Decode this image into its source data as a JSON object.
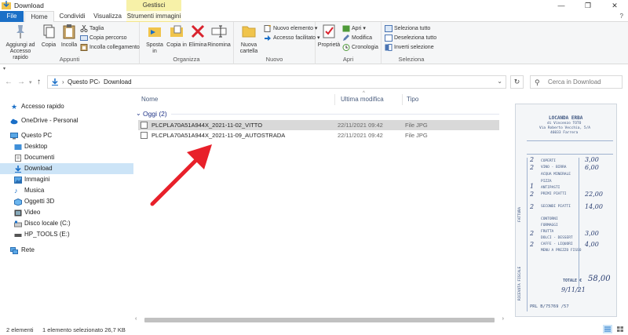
{
  "window": {
    "title": "Download",
    "controls": [
      "—",
      "❐",
      "✕"
    ]
  },
  "ribbon_tabs": {
    "file": "File",
    "home": "Home",
    "condividi": "Condividi",
    "visualizza": "Visualizza",
    "gestisci": "Gestisci",
    "strumenti": "Strumenti immagini",
    "help": "?"
  },
  "ribbon": {
    "appunti": {
      "label": "Appunti",
      "aggiungi": "Aggiungi ad Accesso rapido",
      "copia": "Copia",
      "incolla": "Incolla",
      "taglia": "Taglia",
      "copia_percorso": "Copia percorso",
      "incolla_collegamento": "Incolla collegamento"
    },
    "organizza": {
      "label": "Organizza",
      "sposta": "Sposta in",
      "copia_in": "Copia in",
      "elimina": "Elimina",
      "rinomina": "Rinomina"
    },
    "nuovo": {
      "label": "Nuovo",
      "nuova_cartella": "Nuova cartella",
      "nuovo_elemento": "Nuovo elemento",
      "accesso_facilitato": "Accesso facilitato"
    },
    "apri": {
      "label": "Apri",
      "proprieta": "Proprietà",
      "apri": "Apri",
      "modifica": "Modifica",
      "cronologia": "Cronologia"
    },
    "seleziona": {
      "label": "Seleziona",
      "seleziona_tutto": "Seleziona tutto",
      "deseleziona_tutto": "Deseleziona tutto",
      "inverti": "Inverti selezione"
    }
  },
  "address": {
    "crumbs": [
      "Questo PC",
      "Download"
    ],
    "search_placeholder": "Cerca in Download"
  },
  "nav": {
    "items": [
      {
        "label": "Accesso rapido",
        "icon": "star-icon"
      },
      {
        "label": "OneDrive - Personal",
        "icon": "cloud-icon"
      },
      {
        "label": "Questo PC",
        "icon": "computer-icon"
      },
      {
        "label": "Desktop",
        "icon": "folder-icon"
      },
      {
        "label": "Documenti",
        "icon": "documents-icon"
      },
      {
        "label": "Download",
        "icon": "download-icon"
      },
      {
        "label": "Immagini",
        "icon": "pictures-icon"
      },
      {
        "label": "Musica",
        "icon": "music-icon"
      },
      {
        "label": "Oggetti 3D",
        "icon": "cube-icon"
      },
      {
        "label": "Video",
        "icon": "video-icon"
      },
      {
        "label": "Disco locale (C:)",
        "icon": "drive-icon"
      },
      {
        "label": "HP_TOOLS (E:)",
        "icon": "usb-drive-icon"
      },
      {
        "label": "Rete",
        "icon": "network-icon"
      }
    ]
  },
  "files": {
    "columns": {
      "name": "Nome",
      "date": "Ultima modifica",
      "type": "Tipo"
    },
    "group_title": "Oggi (2)",
    "rows": [
      {
        "name": "PLCPLA70A51A944X_2021-11-02_VITTO",
        "date": "22/11/2021 09:42",
        "type": "File JPG",
        "selected": true
      },
      {
        "name": "PLCPLA70A51A944X_2021-11-09_AUTOSTRADA",
        "date": "22/11/2021 09:42",
        "type": "File JPG",
        "selected": false
      }
    ]
  },
  "preview": {
    "header": [
      "LOCANDA ERBA",
      "di Vincenzo TOTO",
      "Via Roberto Vecchia, 5/A",
      "46033 Farrera"
    ],
    "items": [
      "COPERTI",
      "VINO - BIRRA",
      "ACQUA MINERALE",
      "PIZZA",
      "ANTIPASTI",
      "PRIMI PIATTI",
      "SECONDI PIATTI",
      "CONTORNI",
      "FORMAGGI",
      "FRUTTA",
      "DOLCI - DESSERT",
      "CAFFE - LIQUORI",
      "MENU A PREZZO FISSO"
    ],
    "side_labels": [
      "RICEVUTA FISCALE",
      "FATTURA"
    ],
    "totale_label": "TOTALE €",
    "totale_value": "58,00",
    "serial": "PRL  B/75769  /57",
    "handwritten": [
      "2",
      "3,00",
      "2",
      "6,00",
      "1",
      "2",
      "22,00",
      "2",
      "14,00",
      "2",
      "3,00",
      "2",
      "4,00",
      "9/11/21"
    ]
  },
  "status": {
    "count": "2 elementi",
    "selected": "1 elemento selezionato  26,7 KB"
  },
  "colors": {
    "accent": "#1a6fc7",
    "selection": "#cce4f7",
    "arrow": "#e8202a",
    "gestisci": "#f7f1a8"
  }
}
